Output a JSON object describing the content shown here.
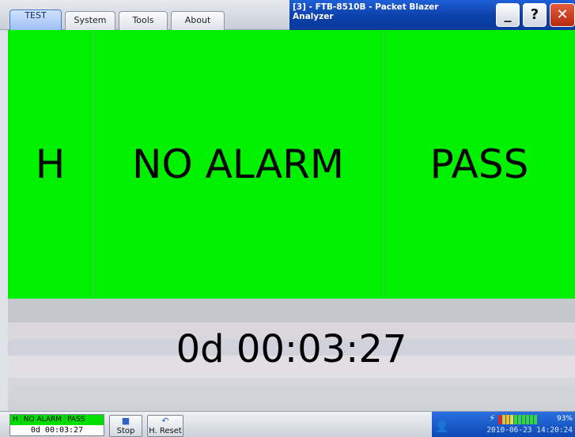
{
  "tabs": [
    {
      "label": "TEST",
      "active": true
    },
    {
      "label": "System",
      "active": false
    },
    {
      "label": "Tools",
      "active": false
    },
    {
      "label": "About",
      "active": false
    }
  ],
  "window": {
    "title": "[3] - FTB-8510B - Packet Blazer Analyzer",
    "minimize_label": "_",
    "help_label": "?",
    "close_label": "✕"
  },
  "status_panels": {
    "history": "H",
    "alarm": "NO ALARM",
    "verdict": "PASS",
    "color": "#00f000"
  },
  "timer": {
    "elapsed": "0d 00:03:27"
  },
  "statusbar": {
    "mini": {
      "history": "H",
      "alarm": "NO ALARM",
      "verdict": "PASS",
      "elapsed": "0d 00:03:27"
    },
    "stop_label": "Stop",
    "reset_label": "H. Reset",
    "battery_percent": "93%",
    "datetime": "2010-06-23 14:20:24",
    "battery_level": 0.93,
    "icons": [
      "user-icon",
      "power-plug-icon",
      "battery-icon"
    ]
  }
}
